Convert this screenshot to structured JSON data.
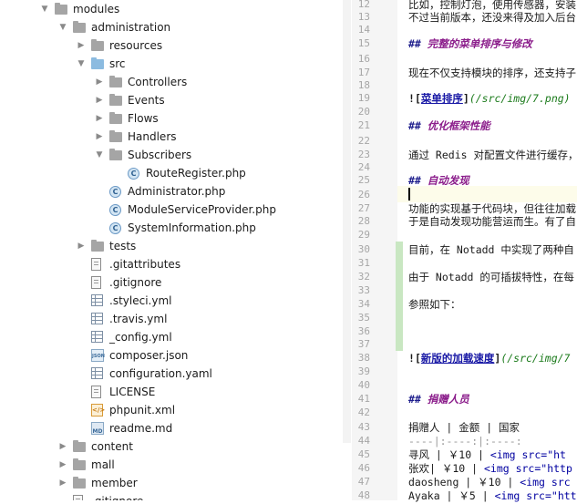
{
  "tree": {
    "items": [
      {
        "label": "modules",
        "icon": "folder-icon",
        "state": "expanded",
        "depth": 0
      },
      {
        "label": "administration",
        "icon": "folder-icon",
        "state": "expanded",
        "depth": 1
      },
      {
        "label": "resources",
        "icon": "folder-icon",
        "state": "collapsed",
        "depth": 2
      },
      {
        "label": "src",
        "icon": "source-folder-icon",
        "state": "expanded",
        "depth": 2
      },
      {
        "label": "Controllers",
        "icon": "folder-icon",
        "state": "collapsed",
        "depth": 3
      },
      {
        "label": "Events",
        "icon": "folder-icon",
        "state": "collapsed",
        "depth": 3
      },
      {
        "label": "Flows",
        "icon": "folder-icon",
        "state": "collapsed",
        "depth": 3
      },
      {
        "label": "Handlers",
        "icon": "folder-icon",
        "state": "collapsed",
        "depth": 3
      },
      {
        "label": "Subscribers",
        "icon": "folder-icon",
        "state": "expanded",
        "depth": 3
      },
      {
        "label": "RouteRegister.php",
        "icon": "php-class-icon",
        "state": "file",
        "depth": 4
      },
      {
        "label": "Administrator.php",
        "icon": "php-class-icon",
        "state": "file",
        "depth": 3
      },
      {
        "label": "ModuleServiceProvider.php",
        "icon": "php-class-icon",
        "state": "file",
        "depth": 3
      },
      {
        "label": "SystemInformation.php",
        "icon": "php-class-icon",
        "state": "file",
        "depth": 3
      },
      {
        "label": "tests",
        "icon": "folder-icon",
        "state": "collapsed",
        "depth": 2
      },
      {
        "label": ".gitattributes",
        "icon": "text-file-icon",
        "state": "file",
        "depth": 2
      },
      {
        "label": ".gitignore",
        "icon": "text-file-icon",
        "state": "file",
        "depth": 2
      },
      {
        "label": ".styleci.yml",
        "icon": "yaml-file-icon",
        "state": "file",
        "depth": 2
      },
      {
        "label": ".travis.yml",
        "icon": "yaml-file-icon",
        "state": "file",
        "depth": 2
      },
      {
        "label": "_config.yml",
        "icon": "yaml-file-icon",
        "state": "file",
        "depth": 2
      },
      {
        "label": "composer.json",
        "icon": "json-file-icon",
        "state": "file",
        "depth": 2
      },
      {
        "label": "configuration.yaml",
        "icon": "yaml-file-icon",
        "state": "file",
        "depth": 2
      },
      {
        "label": "LICENSE",
        "icon": "text-file-icon",
        "state": "file",
        "depth": 2
      },
      {
        "label": "phpunit.xml",
        "icon": "xml-file-icon",
        "state": "file",
        "depth": 2
      },
      {
        "label": "readme.md",
        "icon": "markdown-file-icon",
        "state": "file",
        "depth": 2
      },
      {
        "label": "content",
        "icon": "folder-icon",
        "state": "collapsed",
        "depth": 1
      },
      {
        "label": "mall",
        "icon": "folder-icon",
        "state": "collapsed",
        "depth": 1
      },
      {
        "label": "member",
        "icon": "folder-icon",
        "state": "collapsed",
        "depth": 1
      },
      {
        "label": ".gitignore",
        "icon": "text-file-icon",
        "state": "file",
        "depth": 1
      }
    ],
    "json_icon_text": "JSON",
    "xml_icon_text": "</>",
    "md_icon_text": "MD",
    "php_icon_text": "C"
  },
  "editor": {
    "line_numbers": [
      "12",
      "13",
      "14",
      "15",
      "16",
      "17",
      "18",
      "19",
      "20",
      "21",
      "22",
      "23",
      "24",
      "25",
      "26",
      "27",
      "28",
      "29",
      "30",
      "31",
      "32",
      "33",
      "34",
      "35",
      "36",
      "37",
      "38",
      "39",
      "40",
      "41",
      "42",
      "43",
      "44",
      "45",
      "46",
      "47",
      "48"
    ],
    "lines": {
      "l12": "比如，控制灯泡，使用传感器，安装",
      "l13": "不过当前版本，还没来得及加入后台",
      "l15_mark": "## ",
      "l15_text": "完整的菜单排序与修改",
      "l17": "现在不仅支持模块的排序，还支持子",
      "l19_bang": "!",
      "l19_open": "[",
      "l19_text": "菜单排序",
      "l19_close": "]",
      "l19_url": "(/src/img/7.png)",
      "l21_mark": "## ",
      "l21_text": "优化框架性能",
      "l23": "通过 Redis 对配置文件进行缓存，",
      "l25_mark": "## ",
      "l25_text": "自动发现",
      "l27": "功能的实现基于代码块，但往往加载",
      "l28": "于是自动发现功能营运而生。有了自",
      "l30": "目前，在 Notadd 中实现了两种自",
      "l32": "由于 Notadd 的可插拔特性，在每",
      "l34": "参照如下：",
      "l38_bang": "!",
      "l38_open": "[",
      "l38_text": "新版的加载速度",
      "l38_close": "]",
      "l38_url": "(/src/img/7",
      "l41_mark": "## ",
      "l41_text": "捐赠人员",
      "l43": "捐赠人 | 金额 | 国家",
      "l44": "----|:----:|:----:",
      "l45_a": "寻风 | ￥10  | ",
      "l45_b": "<img src=\"ht",
      "l46_a": "张欢| ￥10  | ",
      "l46_b": "<img src=\"http",
      "l47_a": "daosheng | ￥10  | ",
      "l47_b": "<img src",
      "l48_a": "Ayaka | ￥5  | ",
      "l48_b": "<img src=\"htt"
    }
  }
}
